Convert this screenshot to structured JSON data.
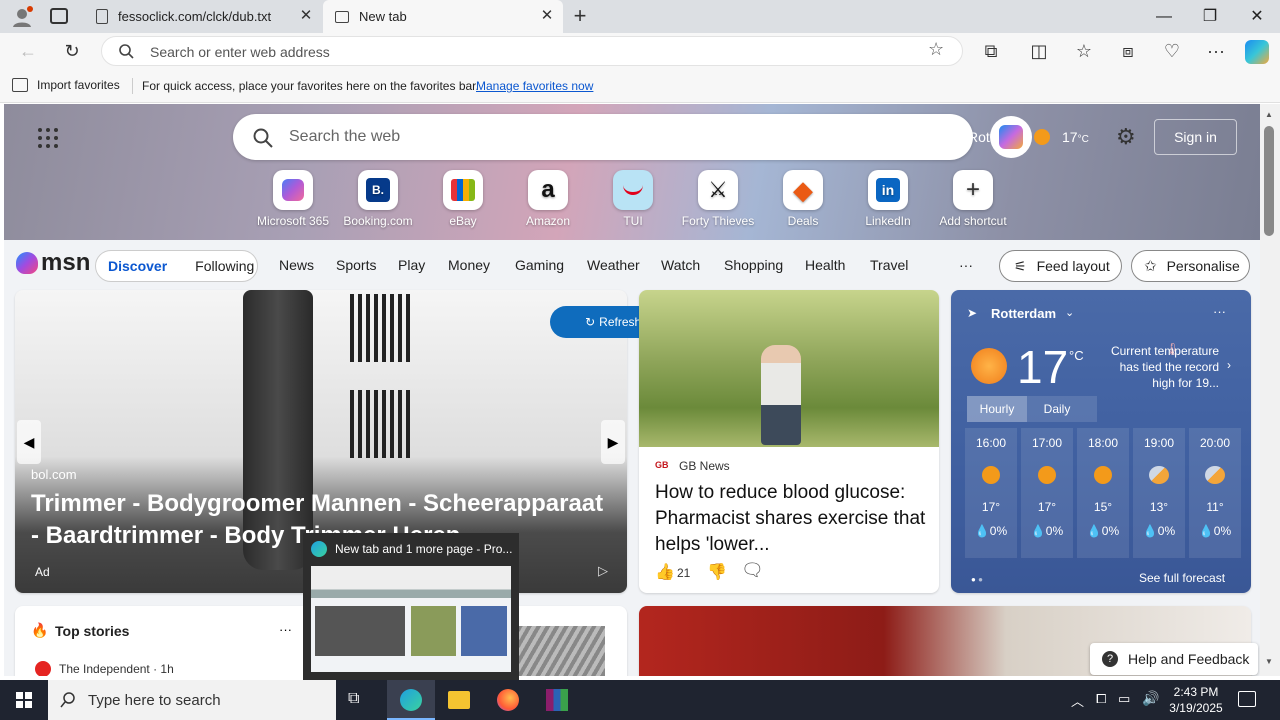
{
  "browser": {
    "tabs": [
      {
        "title": "fessoclick.com/clck/dub.txt",
        "active": false
      },
      {
        "title": "New tab",
        "active": true
      }
    ],
    "address_placeholder": "Search or enter web address",
    "favorites_bar": {
      "import_label": "Import favorites",
      "message": "For quick access, place your favorites here on the favorites bar.",
      "manage_link": "Manage favorites now"
    }
  },
  "newtab": {
    "search_placeholder": "Search the web",
    "location_partial": "Rotterdam",
    "temperature": "17",
    "temp_unit": "°C",
    "sign_in": "Sign in",
    "shortcuts": [
      {
        "label": "Microsoft 365",
        "icon": "microsoft-365-icon"
      },
      {
        "label": "Booking.com",
        "icon": "booking-icon",
        "glyph": "B."
      },
      {
        "label": "eBay",
        "icon": "ebay-icon"
      },
      {
        "label": "Amazon",
        "icon": "amazon-icon",
        "glyph": "a"
      },
      {
        "label": "TUI",
        "icon": "tui-icon"
      },
      {
        "label": "Forty Thieves",
        "icon": "forty-thieves-icon",
        "glyph": "⚔"
      },
      {
        "label": "Deals",
        "icon": "deals-icon",
        "glyph": "◆"
      },
      {
        "label": "LinkedIn",
        "icon": "linkedin-icon",
        "glyph": "in"
      },
      {
        "label": "Add shortcut",
        "icon": "plus-icon",
        "glyph": "+"
      }
    ]
  },
  "msn": {
    "logo": "msn",
    "tabs": [
      "Discover",
      "Following"
    ],
    "categories": [
      "News",
      "Sports",
      "Play",
      "Money",
      "Gaming",
      "Weather",
      "Watch",
      "Shopping",
      "Health",
      "Travel"
    ],
    "more": "···",
    "feed_layout": "Feed layout",
    "personalise": "Personalise",
    "refresh": "Refresh stories"
  },
  "ad_card": {
    "source": "bol.com",
    "title": "Trimmer - Bodygroomer Mannen - Scheerapparaat - Baardtrimmer - Body Trimmer Heren - Schaamstre...",
    "badge": "Ad"
  },
  "news_card": {
    "source": "GB News",
    "title": "How to reduce blood glucose: Pharmacist shares exercise that helps 'lower...",
    "likes": "21"
  },
  "weather": {
    "city": "Rotterdam",
    "temp": "17",
    "unit": "°C",
    "note": "Current temperature has tied the record high for 19...",
    "tabs": [
      "Hourly",
      "Daily"
    ],
    "hourly": [
      {
        "time": "16:00",
        "temp": "17°",
        "rain": "0%",
        "icon": "sun-icon"
      },
      {
        "time": "17:00",
        "temp": "17°",
        "rain": "0%",
        "icon": "sun-icon"
      },
      {
        "time": "18:00",
        "temp": "15°",
        "rain": "0%",
        "icon": "sun-icon"
      },
      {
        "time": "19:00",
        "temp": "13°",
        "rain": "0%",
        "icon": "moon-cloud-icon"
      },
      {
        "time": "20:00",
        "temp": "11°",
        "rain": "0%",
        "icon": "moon-cloud-icon"
      }
    ],
    "forecast_link": "See full forecast"
  },
  "top_stories": {
    "title": "Top stories",
    "first_source": "The Independent · 1h"
  },
  "taskbar_preview": {
    "title": "New tab and 1 more page - Pro..."
  },
  "help": "Help and Feedback",
  "taskbar": {
    "search_placeholder": "Type here to search",
    "time": "2:43 PM",
    "date": "3/19/2025"
  }
}
